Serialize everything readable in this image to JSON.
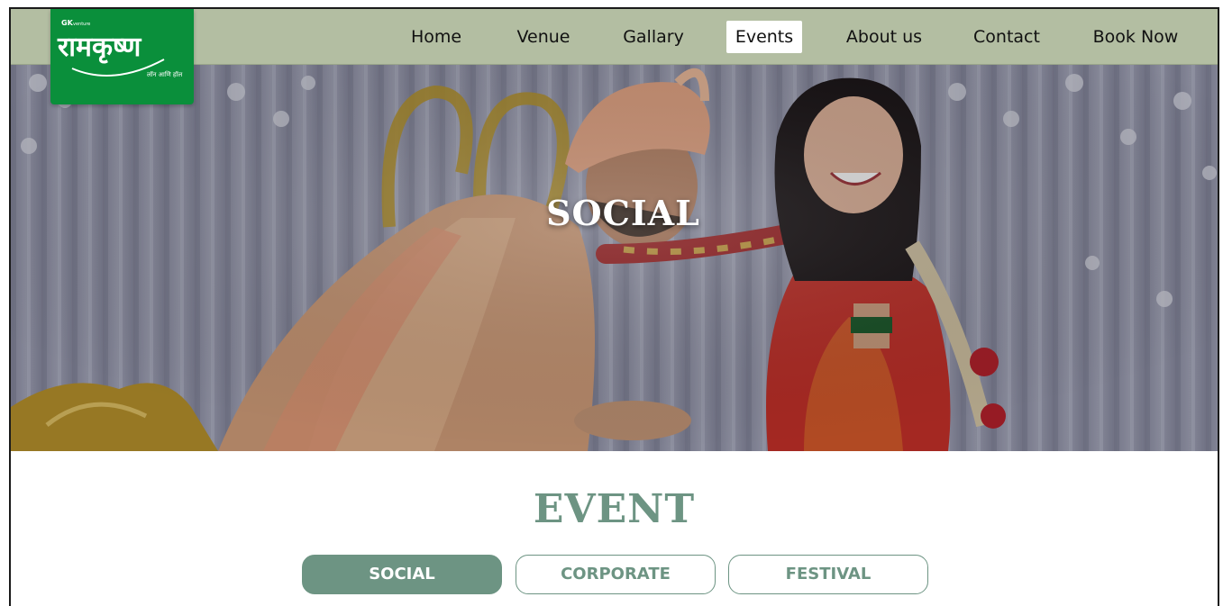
{
  "logo": {
    "brand_small": "GK",
    "brand_small_suffix": "venture",
    "brand_main": "रामकृष्ण",
    "brand_sub": "लॉन आणि हॉल"
  },
  "nav": {
    "items": [
      {
        "label": "Home",
        "active": false
      },
      {
        "label": "Venue",
        "active": false
      },
      {
        "label": "Gallary",
        "active": false
      },
      {
        "label": "Events",
        "active": true
      },
      {
        "label": "About us",
        "active": false
      },
      {
        "label": "Contact",
        "active": false
      },
      {
        "label": "Book Now",
        "active": false
      }
    ]
  },
  "hero": {
    "title": "SOCIAL"
  },
  "events": {
    "title": "EVENT",
    "tabs": [
      {
        "label": "SOCIAL",
        "active": true
      },
      {
        "label": "CORPORATE",
        "active": false
      },
      {
        "label": "FESTIVAL",
        "active": false
      }
    ]
  },
  "colors": {
    "nav_bg": "#b3bea2",
    "logo_bg": "#0a8f3b",
    "accent": "#6d9483"
  }
}
